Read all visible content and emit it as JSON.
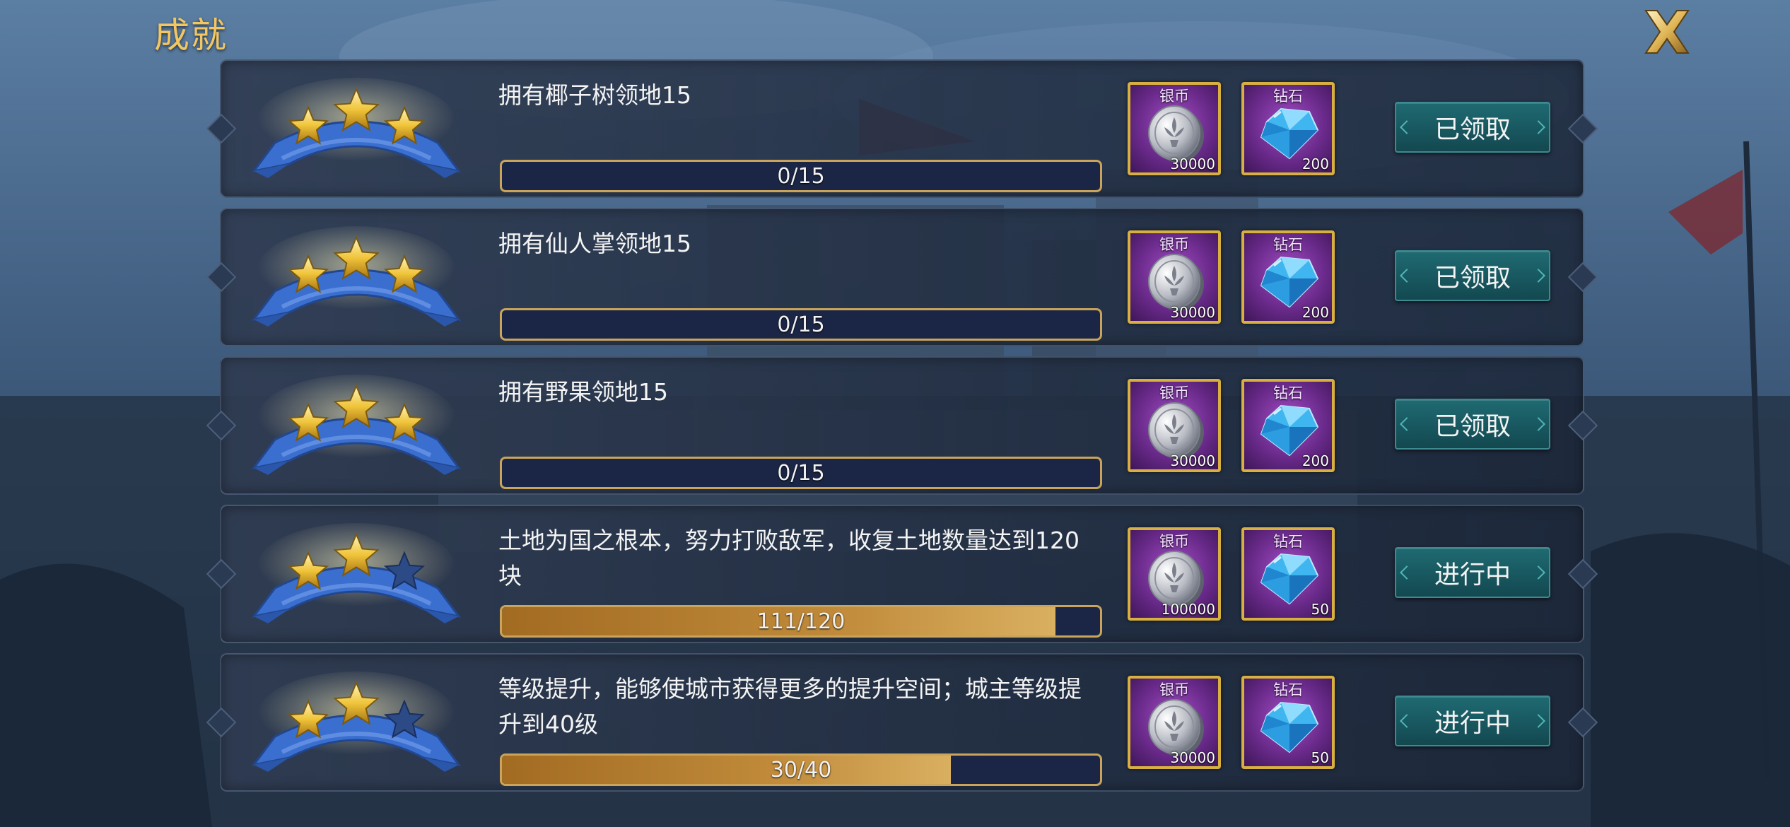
{
  "header": {
    "title": "成就"
  },
  "close_icon": "close-x-icon",
  "colors": {
    "title": "#f2c661",
    "progress_fill": "#c08a3a",
    "button": "#1f6a72",
    "reward_frame": "#d8b040"
  },
  "achievements": [
    {
      "stars_earned": 3,
      "stars_total": 3,
      "description": "拥有椰子树领地15",
      "progress": {
        "label": "0/15",
        "current": 0,
        "target": 15
      },
      "rewards": [
        {
          "name": "银币",
          "icon": "silver-coin-icon",
          "qty": "30000"
        },
        {
          "name": "钻石",
          "icon": "diamond-icon",
          "qty": "200"
        }
      ],
      "button": "已领取"
    },
    {
      "stars_earned": 3,
      "stars_total": 3,
      "description": "拥有仙人掌领地15",
      "progress": {
        "label": "0/15",
        "current": 0,
        "target": 15
      },
      "rewards": [
        {
          "name": "银币",
          "icon": "silver-coin-icon",
          "qty": "30000"
        },
        {
          "name": "钻石",
          "icon": "diamond-icon",
          "qty": "200"
        }
      ],
      "button": "已领取"
    },
    {
      "stars_earned": 3,
      "stars_total": 3,
      "description": "拥有野果领地15",
      "progress": {
        "label": "0/15",
        "current": 0,
        "target": 15
      },
      "rewards": [
        {
          "name": "银币",
          "icon": "silver-coin-icon",
          "qty": "30000"
        },
        {
          "name": "钻石",
          "icon": "diamond-icon",
          "qty": "200"
        }
      ],
      "button": "已领取"
    },
    {
      "stars_earned": 2,
      "stars_total": 3,
      "description": "土地为国之根本，努力打败敌军，收复土地数量达到120块",
      "progress": {
        "label": "111/120",
        "current": 111,
        "target": 120
      },
      "rewards": [
        {
          "name": "银币",
          "icon": "silver-coin-icon",
          "qty": "100000"
        },
        {
          "name": "钻石",
          "icon": "diamond-icon",
          "qty": "50"
        }
      ],
      "button": "进行中"
    },
    {
      "stars_earned": 2,
      "stars_total": 3,
      "description": "等级提升，能够使城市获得更多的提升空间；城主等级提升到40级",
      "progress": {
        "label": "30/40",
        "current": 30,
        "target": 40
      },
      "rewards": [
        {
          "name": "银币",
          "icon": "silver-coin-icon",
          "qty": "30000"
        },
        {
          "name": "钻石",
          "icon": "diamond-icon",
          "qty": "50"
        }
      ],
      "button": "进行中"
    }
  ]
}
